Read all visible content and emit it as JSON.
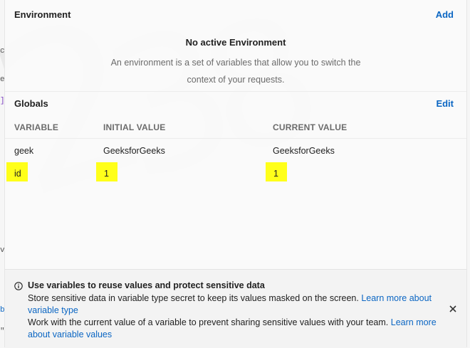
{
  "environment": {
    "heading": "Environment",
    "add_label": "Add",
    "empty_title": "No active Environment",
    "empty_description": "An environment is a set of variables that allow you to switch the context of your requests."
  },
  "globals": {
    "heading": "Globals",
    "edit_label": "Edit",
    "columns": [
      "VARIABLE",
      "INITIAL VALUE",
      "CURRENT VALUE"
    ],
    "rows": [
      {
        "variable": "geek",
        "initial": "GeeksforGeeks",
        "current": "GeeksforGeeks"
      },
      {
        "variable": "id",
        "initial": "1",
        "current": "1"
      }
    ]
  },
  "banner": {
    "title": "Use variables to reuse values and protect sensitive data",
    "line1_text": "Store sensitive data in variable type secret to keep its values masked on the screen.",
    "line1_link": "Learn more about variable type",
    "line2_text": "Work with the current value of a variable to prevent sharing sensitive values with your team.",
    "line2_link": "Learn more about variable values"
  },
  "colors": {
    "highlight": "#ffff1a",
    "link": "#0b66c3"
  },
  "icons": {
    "info": "info-icon",
    "close": "close-icon"
  }
}
